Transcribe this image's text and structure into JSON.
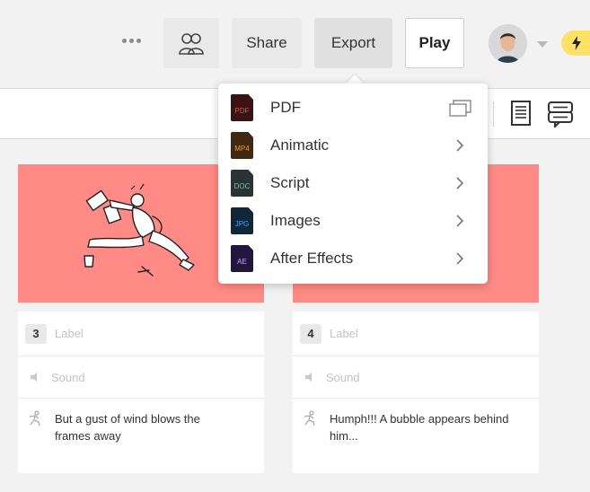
{
  "topbar": {
    "more_icon": "more-dots-icon",
    "collaborators_icon": "collaborators-icon",
    "share_label": "Share",
    "export_label": "Export",
    "play_label": "Play",
    "avatar_icon": "avatar",
    "upgrade_icon": "lightning-icon"
  },
  "toolbar": {
    "script_icon": "script-view-icon",
    "comments_icon": "comments-icon"
  },
  "export_menu": {
    "items": [
      {
        "label": "PDF",
        "badge": "PDF",
        "icon_bg": "#3a1414",
        "badge_color": "#e2554e",
        "trailing": "duplicate-icon"
      },
      {
        "label": "Animatic",
        "badge": "MP4",
        "icon_bg": "#3f2912",
        "badge_color": "#e59a3c",
        "trailing": "chevron-right-icon"
      },
      {
        "label": "Script",
        "badge": "DOC",
        "icon_bg": "#2a3434",
        "badge_color": "#6fc0a6",
        "trailing": "chevron-right-icon"
      },
      {
        "label": "Images",
        "badge": "JPG",
        "icon_bg": "#10263a",
        "badge_color": "#3fa3f0",
        "trailing": "chevron-right-icon"
      },
      {
        "label": "After Effects",
        "badge": "AE",
        "icon_bg": "#22153e",
        "badge_color": "#c8a6ff",
        "trailing": "chevron-right-icon"
      }
    ]
  },
  "frames": [
    {
      "number": "3",
      "label_placeholder": "Label",
      "sound_placeholder": "Sound",
      "action_text": "But a gust of wind blows the frames away",
      "thumb_color": "#ff8a86"
    },
    {
      "number": "4",
      "label_placeholder": "Label",
      "sound_placeholder": "Sound",
      "action_text": "Humph!!! A bubble appears behind him...",
      "thumb_color": "#ff8a86"
    }
  ]
}
